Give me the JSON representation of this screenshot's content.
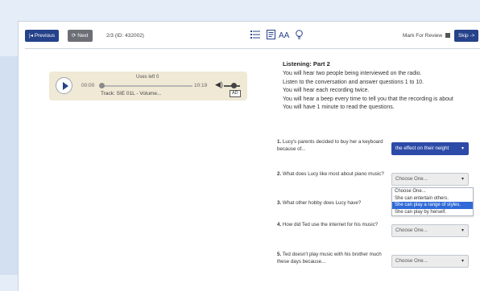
{
  "toolbar": {
    "previous_label": "|◂ Previous",
    "next_label": "⟳ Next",
    "question_counter": "2/3 (ID: 432002)",
    "mark_review_label": "Mark For Review",
    "skip_label": "Skip ->"
  },
  "icons": {
    "list": "list-icon",
    "notepad": "notepad-icon",
    "text_size": "text-size-icon",
    "hint": "lightbulb-icon",
    "text_size_glyph": "AA"
  },
  "player": {
    "uses_left": "Uses left 0",
    "time_start": "00:00",
    "time_end": "10:19",
    "track": "Track: SIE 01L - Volume...",
    "ad_badge": "AD",
    "progress": 0.0,
    "volume": 0.6
  },
  "content": {
    "title": "Listening: Part 2",
    "instructions": [
      "You will hear two people being interviewed on the radio.",
      "Listen to the conversation and answer questions 1 to 10.",
      "You will hear each recording twice.",
      "You will hear a beep every time to tell you that the recording is about",
      "You will have 1 minute to read the questions."
    ]
  },
  "questions": [
    {
      "number": "1.",
      "text": "Lucy's parents decided to buy her a keyboard because of...",
      "value": "the effect on their neight"
    },
    {
      "number": "2.",
      "text": "What does Lucy like most about piano music?",
      "value": "Choose One..."
    },
    {
      "number": "3.",
      "text": "What other hobby does Lucy have?",
      "value": ""
    },
    {
      "number": "4.",
      "text": "How did Ted use the internet for his music?",
      "value": "Choose One..."
    },
    {
      "number": "5.",
      "text": "Ted doesn't play music with his brother much these days because...",
      "value": "Choose One..."
    }
  ],
  "dropdown_options": [
    "Choose One...",
    "She can entertain others.",
    "She can play a range of styles.",
    "She can play by herself."
  ],
  "colors": {
    "accent": "#25428a",
    "selected_fill": "#2c4aa8",
    "highlight": "#2f6ad8",
    "player_bg": "#efe9d5"
  }
}
